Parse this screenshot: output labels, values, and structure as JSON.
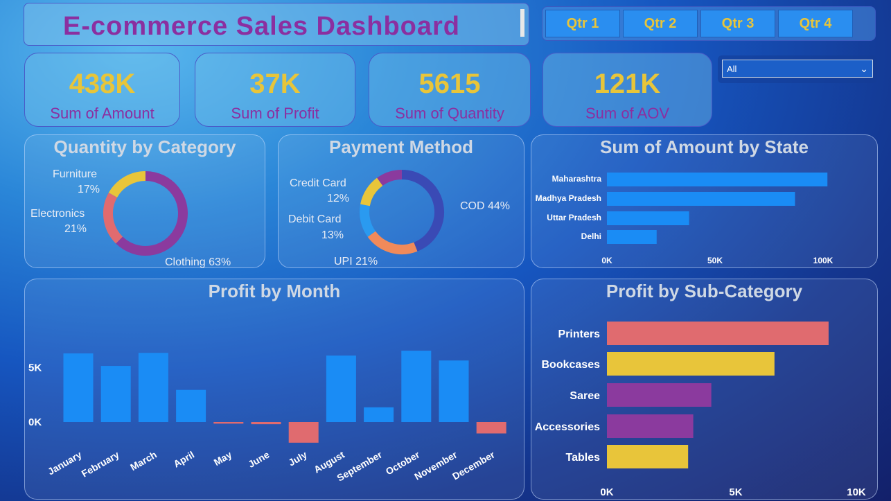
{
  "header": {
    "title": "E-commerce Sales Dashboard"
  },
  "quarters": [
    "Qtr 1",
    "Qtr 2",
    "Qtr 3",
    "Qtr 4"
  ],
  "slicer": {
    "value": "All"
  },
  "kpis": [
    {
      "value": "438K",
      "label": "Sum of Amount"
    },
    {
      "value": "37K",
      "label": "Sum of Profit"
    },
    {
      "value": "5615",
      "label": "Sum of Quantity"
    },
    {
      "value": "121K",
      "label": "Sum of AOV"
    }
  ],
  "panels": {
    "category_title": "Quantity by Category",
    "payment_title": "Payment Method",
    "state_title": "Sum of Amount by State",
    "month_title": "Profit by Month",
    "subcat_title": "Profit by Sub-Category"
  },
  "chart_data": [
    {
      "type": "pie",
      "title": "Quantity by Category",
      "donut": true,
      "slices": [
        {
          "label": "Clothing",
          "pct_label": "63%",
          "value": 63,
          "color": "#8b3a9e"
        },
        {
          "label": "Electronics",
          "pct_label": "21%",
          "value": 21,
          "color": "#e06b6f"
        },
        {
          "label": "Furniture",
          "pct_label": "17%",
          "value": 17,
          "color": "#e8c53a"
        }
      ]
    },
    {
      "type": "pie",
      "title": "Payment Method",
      "donut": true,
      "slices": [
        {
          "label": "COD",
          "pct_label": "44%",
          "value": 44,
          "color": "#3a4ab5"
        },
        {
          "label": "UPI",
          "pct_label": "21%",
          "value": 21,
          "color": "#f08a5a"
        },
        {
          "label": "Debit Card",
          "pct_label": "13%",
          "value": 13,
          "color": "#2a9af0"
        },
        {
          "label": "Credit Card",
          "pct_label": "12%",
          "value": 12,
          "color": "#e8c53a"
        },
        {
          "label": "",
          "pct_label": "",
          "value": 10,
          "color": "#8b3a9e"
        }
      ]
    },
    {
      "type": "bar",
      "title": "Sum of Amount by State",
      "orientation": "horizontal",
      "categories": [
        "Maharashtra",
        "Madhya Pradesh",
        "Uttar Pradesh",
        "Delhi"
      ],
      "values": [
        102000,
        87000,
        38000,
        23000
      ],
      "xlim": [
        0,
        100000
      ],
      "ticks": [
        "0K",
        "50K",
        "100K"
      ],
      "color": "#1a8cf5"
    },
    {
      "type": "bar",
      "title": "Profit by Month",
      "categories": [
        "January",
        "February",
        "March",
        "April",
        "May",
        "June",
        "July",
        "August",
        "September",
        "October",
        "November",
        "December"
      ],
      "values": [
        6300,
        5150,
        6350,
        2950,
        -150,
        -200,
        -1900,
        6100,
        1350,
        6550,
        5650,
        -1050
      ],
      "ticks": [
        "0K",
        "5K"
      ],
      "positive_color": "#1a8cf5",
      "negative_color": "#e06b6f"
    },
    {
      "type": "bar",
      "title": "Profit by Sub-Category",
      "orientation": "horizontal",
      "categories": [
        "Printers",
        "Bookcases",
        "Saree",
        "Accessories",
        "Tables"
      ],
      "values": [
        8600,
        6500,
        4050,
        3350,
        3150
      ],
      "colors": [
        "#e06b6f",
        "#e8c53a",
        "#8b3a9e",
        "#8b3a9e",
        "#e8c53a"
      ],
      "xlim": [
        0,
        10000
      ],
      "ticks": [
        "0K",
        "5K",
        "10K"
      ]
    }
  ]
}
